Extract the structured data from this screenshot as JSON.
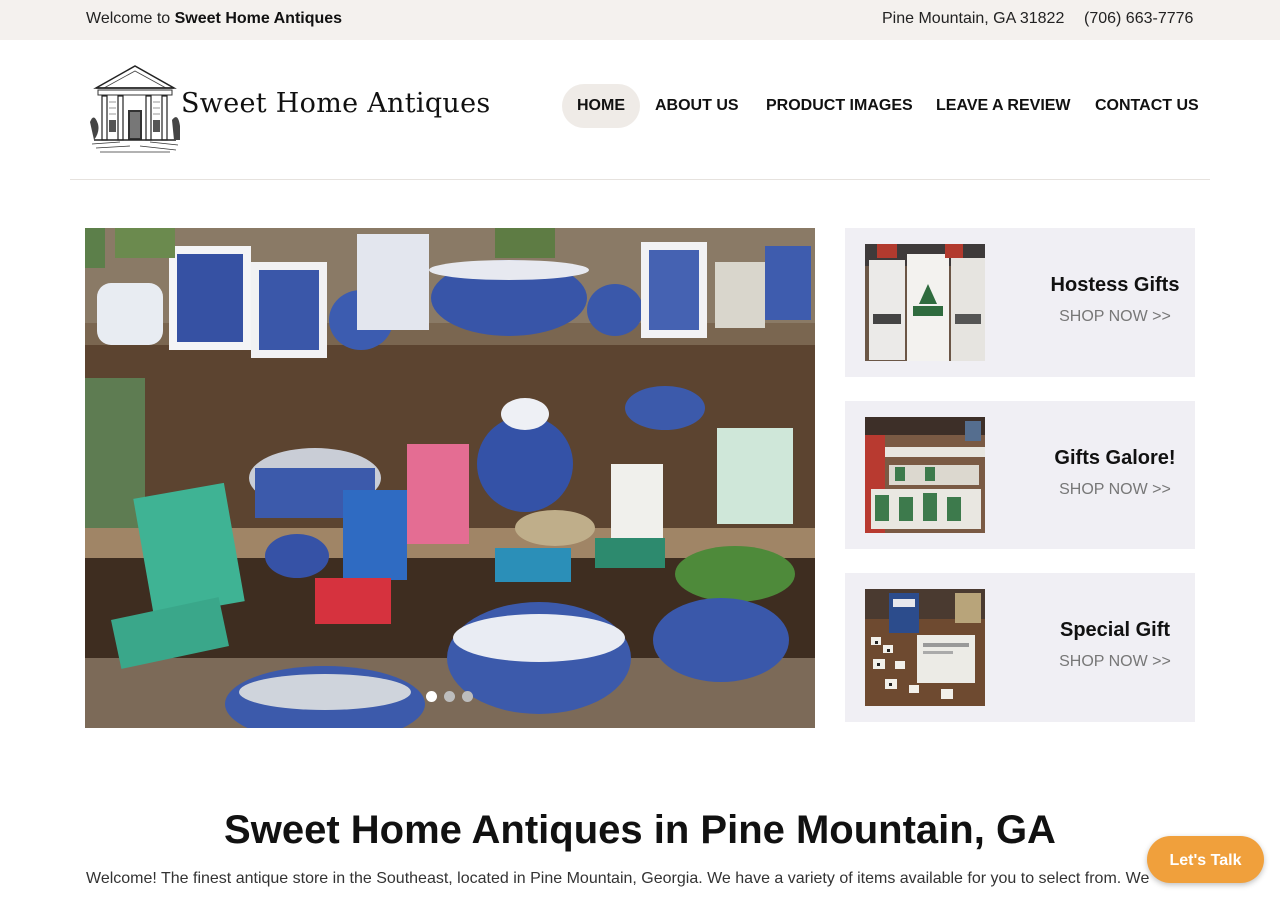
{
  "topbar": {
    "welcome_prefix": "Welcome to ",
    "welcome_name": "Sweet Home Antiques",
    "address": "Pine Mountain, GA 31822",
    "phone": "(706) 663-7776"
  },
  "header": {
    "brand": "Sweet Home Antiques",
    "logo_icon": "house-sketch-icon"
  },
  "nav": {
    "items": [
      {
        "label": "HOME",
        "active": true
      },
      {
        "label": "ABOUT US",
        "active": false
      },
      {
        "label": "PRODUCT IMAGES",
        "active": false
      },
      {
        "label": "LEAVE A REVIEW",
        "active": false
      },
      {
        "label": "CONTACT US",
        "active": false
      }
    ]
  },
  "slider": {
    "slide_count": 3,
    "current_slide": 1
  },
  "promos": [
    {
      "title": "Hostess Gifts",
      "cta": "SHOP NOW >>"
    },
    {
      "title": "Gifts Galore!",
      "cta": "SHOP NOW >>"
    },
    {
      "title": "Special Gift",
      "cta": "SHOP NOW >>"
    }
  ],
  "main": {
    "heading": "Sweet Home Antiques in Pine Mountain, GA",
    "intro": "Welcome! The finest antique store in the Southeast, located in Pine Mountain, Georgia. We have a variety of items available for you to select from. We"
  },
  "chat": {
    "label": "Let's Talk"
  },
  "colors": {
    "topbar_bg": "#f4f1ee",
    "card_bg": "#f0eff4",
    "accent": "#f0a03c",
    "nav_active_bg": "#efebe7"
  }
}
